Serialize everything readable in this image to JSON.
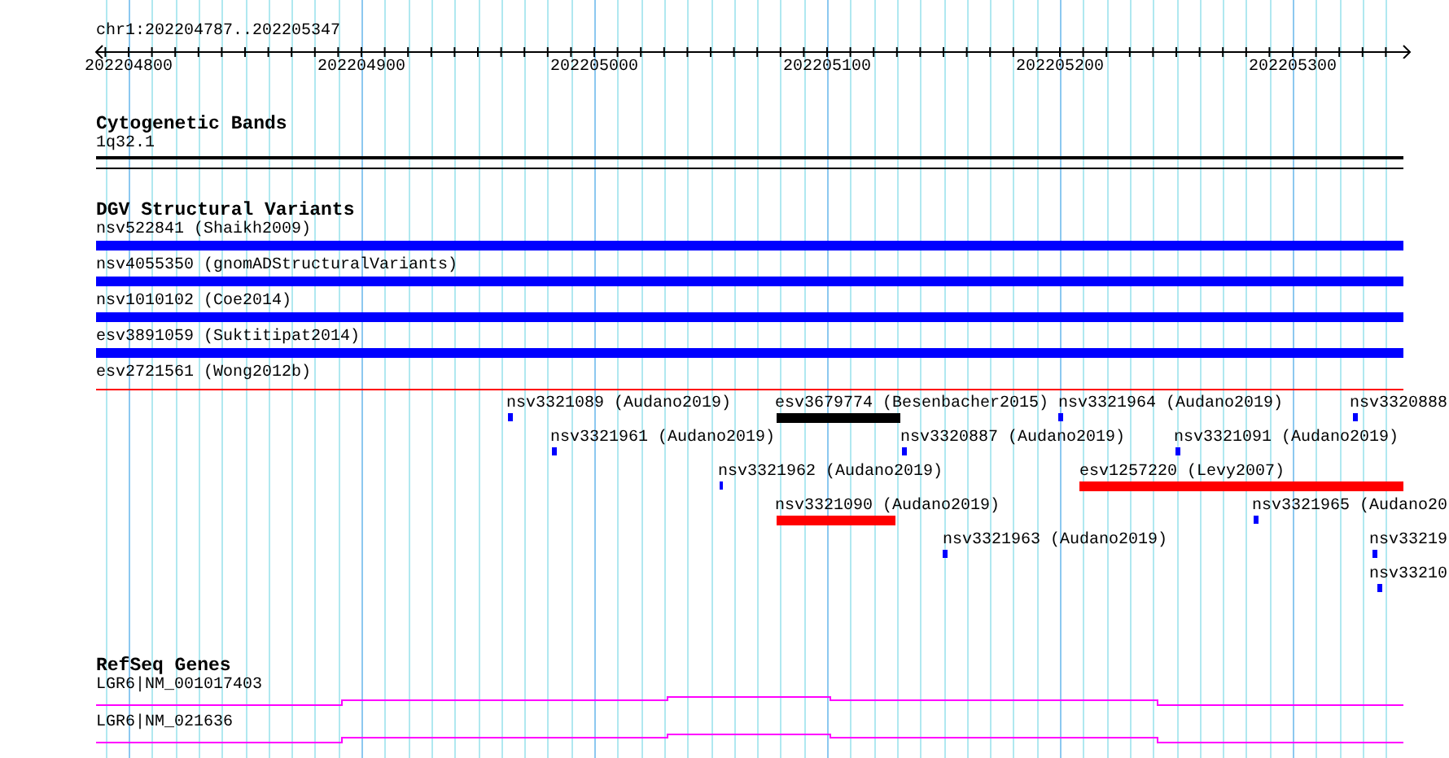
{
  "location": "chr1:202204787..202205347",
  "ruler": {
    "ticks": [
      "202204800",
      "202204900",
      "202205000",
      "202205100",
      "202205200",
      "202205300"
    ]
  },
  "cytobands": {
    "title": "Cytogenetic Bands",
    "features": [
      {
        "label": "1q32.1"
      }
    ]
  },
  "variants": {
    "title": "DGV Structural Variants",
    "full": [
      {
        "label": "nsv522841 (Shaikh2009)",
        "kind": "bar",
        "color": "#0000ff"
      },
      {
        "label": "nsv4055350 (gnomADStructuralVariants)",
        "kind": "bar",
        "color": "#0000ff"
      },
      {
        "label": "nsv1010102 (Coe2014)",
        "kind": "bar",
        "color": "#0000ff"
      },
      {
        "label": "esv3891059 (Suktitipat2014)",
        "kind": "bar",
        "color": "#0000ff"
      },
      {
        "label": "esv2721561 (Wong2012b)",
        "kind": "thin",
        "color": "#ff0000"
      }
    ],
    "placed": [
      {
        "label": "nsv3321089 (Audano2019)",
        "color": "#0000ff"
      },
      {
        "label": "esv3679774 (Besenbacher2015)",
        "color": "#000000"
      },
      {
        "label": "nsv3321964 (Audano2019)",
        "color": "#0000ff"
      },
      {
        "label": "nsv3320888",
        "color": "#0000ff"
      },
      {
        "label": "nsv3321961 (Audano2019)",
        "color": "#0000ff"
      },
      {
        "label": "nsv3320887 (Audano2019)",
        "color": "#0000ff"
      },
      {
        "label": "nsv3321091 (Audano2019)",
        "color": "#0000ff"
      },
      {
        "label": "nsv3321962 (Audano2019)",
        "color": "#0000ff"
      },
      {
        "label": "esv1257220 (Levy2007)",
        "color": "#ff0000"
      },
      {
        "label": "nsv3321090 (Audano2019)",
        "color": "#ff0000"
      },
      {
        "label": "nsv3321965 (Audano20",
        "color": "#0000ff"
      },
      {
        "label": "nsv3321963 (Audano2019)",
        "color": "#0000ff"
      },
      {
        "label": "nsv33219",
        "color": "#0000ff"
      },
      {
        "label": "nsv33210",
        "color": "#0000ff"
      }
    ]
  },
  "genes": {
    "title": "RefSeq Genes",
    "features": [
      {
        "label": "LGR6|NM_001017403"
      },
      {
        "label": "LGR6|NM_021636"
      }
    ]
  }
}
